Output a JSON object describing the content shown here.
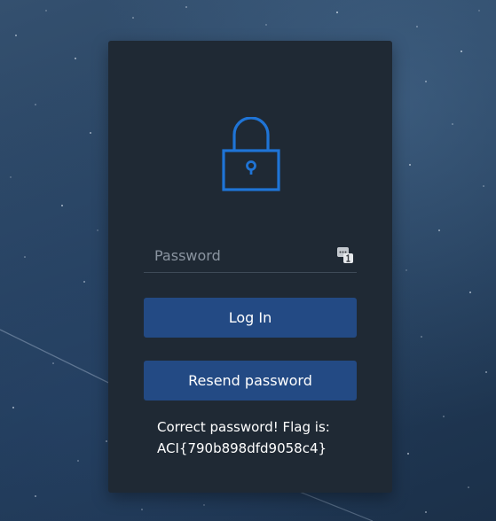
{
  "colors": {
    "accent": "#1f74d6",
    "button_bg": "#234a84",
    "card_bg": "#1f2934"
  },
  "login": {
    "lock_icon": "padlock-icon",
    "password_placeholder": "Password",
    "password_value": "",
    "password_manager_icon": "password-manager-icon",
    "login_label": "Log In",
    "resend_label": "Resend password",
    "message_line1": "Correct password! Flag is:",
    "message_line2": "ACI{790b898dfd9058c4}"
  }
}
